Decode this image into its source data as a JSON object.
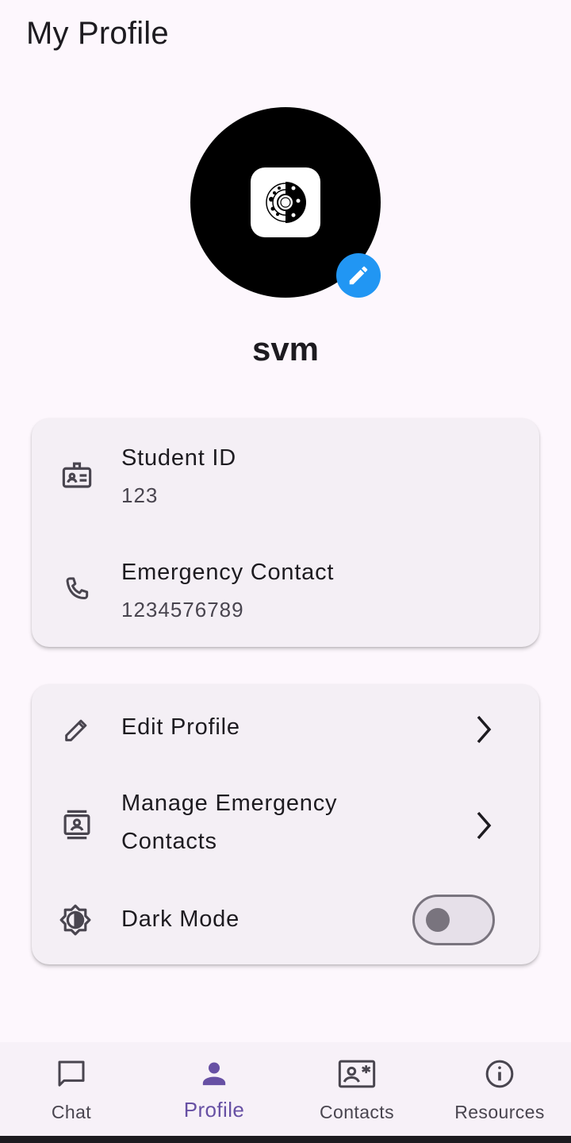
{
  "header": {
    "title": "My Profile"
  },
  "profile": {
    "username": "svm"
  },
  "info_card": {
    "student_id_label": "Student ID",
    "student_id_value": "123",
    "emergency_label": "Emergency Contact",
    "emergency_value": "1234576789"
  },
  "actions_card": {
    "edit_profile": "Edit Profile",
    "manage_contacts_line1": "Manage Emergency",
    "manage_contacts_line2": "Contacts",
    "dark_mode": "Dark Mode",
    "dark_mode_on": false
  },
  "bottom_nav": {
    "items": [
      {
        "label": "Chat",
        "icon": "chat-bubble-icon"
      },
      {
        "label": "Profile",
        "icon": "person-icon"
      },
      {
        "label": "Contacts",
        "icon": "contact-card-icon"
      },
      {
        "label": "Resources",
        "icon": "info-icon"
      }
    ],
    "active_index": 1
  },
  "colors": {
    "background": "#fdf7fd",
    "card": "#f4eff5",
    "accent": "#6750a4",
    "edit_badge": "#2196f3"
  }
}
